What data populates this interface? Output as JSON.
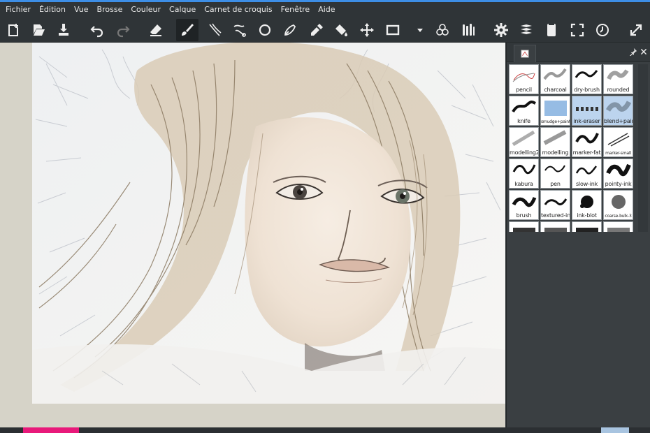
{
  "menu": [
    "Fichier",
    "Édition",
    "Vue",
    "Brosse",
    "Couleur",
    "Calque",
    "Carnet de croquis",
    "Fenêtre",
    "Aide"
  ],
  "toolbar": {
    "tools": [
      {
        "name": "new-document-icon"
      },
      {
        "name": "open-document-icon"
      },
      {
        "name": "save-icon"
      },
      {
        "name": "undo-icon"
      },
      {
        "name": "redo-icon"
      },
      {
        "name": "eraser-icon"
      },
      {
        "name": "brush-icon",
        "active": true
      },
      {
        "name": "ink-lines-icon"
      },
      {
        "name": "curve-tool-icon"
      },
      {
        "name": "ellipse-tool-icon"
      },
      {
        "name": "pen-tool-icon"
      },
      {
        "name": "color-picker-icon"
      },
      {
        "name": "fill-bucket-icon"
      },
      {
        "name": "move-tool-icon"
      },
      {
        "name": "frame-tool-icon"
      },
      {
        "name": "dropdown-arrow-icon"
      },
      {
        "name": "color-circles-icon"
      },
      {
        "name": "brushes-icon"
      },
      {
        "name": "settings-gear-icon"
      },
      {
        "name": "layers-stack-icon"
      },
      {
        "name": "scratchpad-icon"
      },
      {
        "name": "fullscreen-icon"
      },
      {
        "name": "history-clock-icon"
      },
      {
        "name": "expand-icon"
      }
    ]
  },
  "brushes": [
    {
      "label": "pencil"
    },
    {
      "label": "charcoal"
    },
    {
      "label": "dry-brush"
    },
    {
      "label": "rounded"
    },
    {
      "label": "knife"
    },
    {
      "label": "smudge+paint",
      "tiny": true
    },
    {
      "label": "ink-eraser",
      "selected": true
    },
    {
      "label": "blend+paint",
      "selected": true
    },
    {
      "label": "modelling2"
    },
    {
      "label": "modelling"
    },
    {
      "label": "marker-fat"
    },
    {
      "label": "marker-small",
      "tiny": true
    },
    {
      "label": "kabura"
    },
    {
      "label": "pen"
    },
    {
      "label": "slow-ink"
    },
    {
      "label": "pointy-ink"
    },
    {
      "label": "brush"
    },
    {
      "label": "textured-ink"
    },
    {
      "label": "ink-blot"
    },
    {
      "label": "coarse-bulk-3",
      "tiny": true
    },
    {
      "label": ""
    },
    {
      "label": ""
    },
    {
      "label": ""
    },
    {
      "label": ""
    }
  ],
  "colors": {
    "accent": "#3d8ee6",
    "current_color": "#e8197a",
    "selected_brush_bg": "#bcd4ee"
  }
}
